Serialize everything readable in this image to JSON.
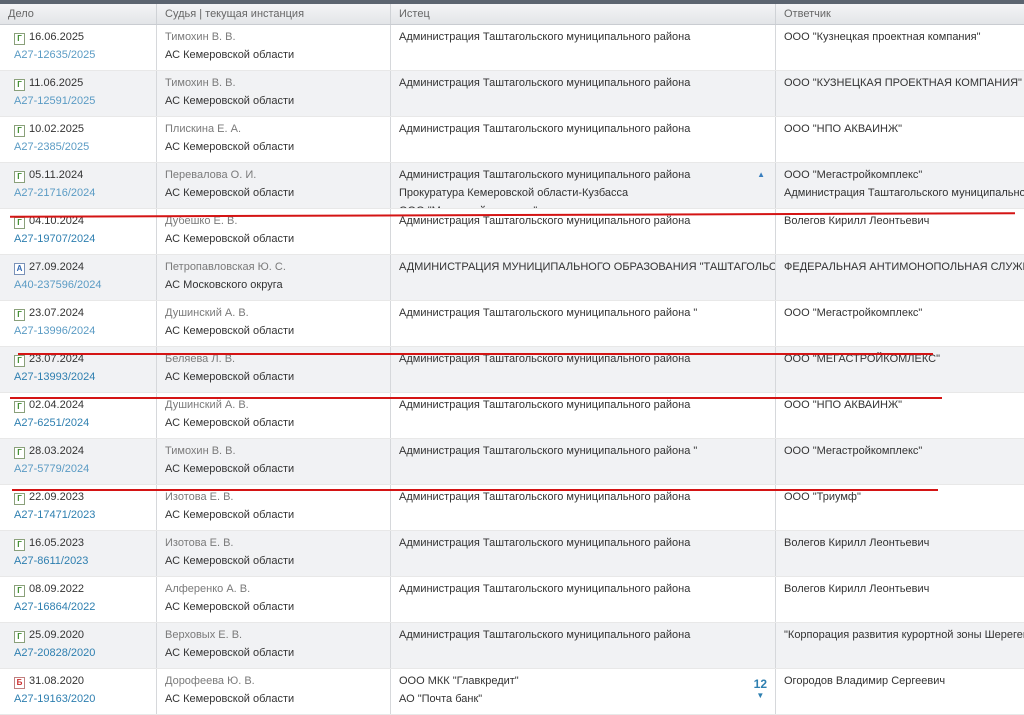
{
  "header": {
    "case": "Дело",
    "judge": "Судья | текущая инстанция",
    "plaintiff": "Истец",
    "defendant": "Ответчик"
  },
  "rows": [
    {
      "icon": "Г",
      "date": "16.06.2025",
      "num": "А27-12635/2025",
      "bold": false,
      "judge": "Тимохин В. В.",
      "court": "АС Кемеровской области",
      "plaintiffs": [
        "Администрация Таштагольского муниципального района"
      ],
      "defendants": [
        "ООО \"Кузнецкая проектная компания\""
      ]
    },
    {
      "icon": "Г",
      "date": "11.06.2025",
      "num": "А27-12591/2025",
      "bold": false,
      "judge": "Тимохин В. В.",
      "court": "АС Кемеровской области",
      "plaintiffs": [
        "Администрация Таштагольского муниципального района"
      ],
      "defendants": [
        "ООО \"КУЗНЕЦКАЯ ПРОЕКТНАЯ КОМПАНИЯ\""
      ]
    },
    {
      "icon": "Г",
      "date": "10.02.2025",
      "num": "А27-2385/2025",
      "bold": false,
      "judge": "Плискина Е. А.",
      "court": "АС Кемеровской области",
      "plaintiffs": [
        "Администрация Таштагольского муниципального района"
      ],
      "defendants": [
        "ООО \"НПО АКВАИНЖ\""
      ]
    },
    {
      "icon": "Г",
      "date": "05.11.2024",
      "num": "А27-21716/2024",
      "bold": false,
      "judge": "Перевалова О. И.",
      "court": "АС Кемеровской области",
      "plaintiffs": [
        "Администрация Таштагольского муниципального района",
        "Прокуратура Кемеровской области-Кузбасса",
        "ООО \"Мегастройкомплекс\""
      ],
      "defendants": [
        "ООО \"Мегастройкомплекс\"",
        "Администрация Таштагольского муниципального района"
      ],
      "expanded": true
    },
    {
      "icon": "Г",
      "date": "04.10.2024",
      "num": "А27-19707/2024",
      "bold": true,
      "judge": "Дубешко Е. В.",
      "court": "АС Кемеровской области",
      "plaintiffs": [
        "Администрация Таштагольского муниципального района"
      ],
      "defendants": [
        "Волегов Кирилл Леонтьевич"
      ]
    },
    {
      "icon": "А",
      "date": "27.09.2024",
      "num": "А40-237596/2024",
      "bold": false,
      "judge": "Петропавловская Ю. С.",
      "court": "АС Московского округа",
      "plaintiffs": [
        "АДМИНИСТРАЦИЯ МУНИЦИПАЛЬНОГО ОБРАЗОВАНИЯ \"ТАШТАГОЛЬСКИЙ МУНИЦИПАЛЬНЫЙ РАЙОН\""
      ],
      "defendants": [
        "ФЕДЕРАЛЬНАЯ АНТИМОНОПОЛЬНАЯ СЛУЖБА"
      ]
    },
    {
      "icon": "Г",
      "date": "23.07.2024",
      "num": "А27-13996/2024",
      "bold": false,
      "judge": "Душинский А. В.",
      "court": "АС Кемеровской области",
      "plaintiffs": [
        "Администрация Таштагольского муниципального района \""
      ],
      "defendants": [
        "ООО \"Мегастройкомплекс\""
      ]
    },
    {
      "icon": "Г",
      "date": "23.07.2024",
      "num": "А27-13993/2024",
      "bold": true,
      "judge": "Беляева Л. В.",
      "court": "АС Кемеровской области",
      "plaintiffs": [
        "Администрация Таштагольского муниципального района"
      ],
      "defendants": [
        "ООО \"МЕГАСТРОЙКОМЛЕКС\""
      ]
    },
    {
      "icon": "Г",
      "date": "02.04.2024",
      "num": "А27-6251/2024",
      "bold": true,
      "judge": "Душинский А. В.",
      "court": "АС Кемеровской области",
      "plaintiffs": [
        "Администрация Таштагольского муниципального района"
      ],
      "defendants": [
        "ООО \"НПО АКВАИНЖ\""
      ]
    },
    {
      "icon": "Г",
      "date": "28.03.2024",
      "num": "А27-5779/2024",
      "bold": false,
      "judge": "Тимохин В. В.",
      "court": "АС Кемеровской области",
      "plaintiffs": [
        "Администрация Таштагольского муниципального района \""
      ],
      "defendants": [
        "ООО \"Мегастройкомплекс\""
      ]
    },
    {
      "icon": "Г",
      "date": "22.09.2023",
      "num": "А27-17471/2023",
      "bold": true,
      "judge": "Изотова Е. В.",
      "court": "АС Кемеровской области",
      "plaintiffs": [
        "Администрация Таштагольского муниципального района"
      ],
      "defendants": [
        "ООО \"Триумф\""
      ]
    },
    {
      "icon": "Г",
      "date": "16.05.2023",
      "num": "А27-8611/2023",
      "bold": true,
      "judge": "Изотова Е. В.",
      "court": "АС Кемеровской области",
      "plaintiffs": [
        "Администрация Таштагольского муниципального района"
      ],
      "defendants": [
        "Волегов Кирилл Леонтьевич"
      ]
    },
    {
      "icon": "Г",
      "date": "08.09.2022",
      "num": "А27-16864/2022",
      "bold": true,
      "judge": "Алференко А. В.",
      "court": "АС Кемеровской области",
      "plaintiffs": [
        "Администрация Таштагольского муниципального района"
      ],
      "defendants": [
        "Волегов Кирилл Леонтьевич"
      ]
    },
    {
      "icon": "Г",
      "date": "25.09.2020",
      "num": "А27-20828/2020",
      "bold": true,
      "judge": "Верховых Е. В.",
      "court": "АС Кемеровской области",
      "plaintiffs": [
        "Администрация Таштагольского муниципального района"
      ],
      "defendants": [
        "\"Корпорация развития курортной зоны Шерегеш\""
      ]
    },
    {
      "icon": "Б",
      "date": "31.08.2020",
      "num": "А27-19163/2020",
      "bold": true,
      "judge": "Дорофеева Ю. В.",
      "court": "АС Кемеровской области",
      "plaintiffs": [
        "ООО МКК \"Главкредит\"",
        "АО \"Почта банк\""
      ],
      "defendants": [
        "Огородов Владимир Сергеевич"
      ],
      "counter": "12"
    }
  ]
}
